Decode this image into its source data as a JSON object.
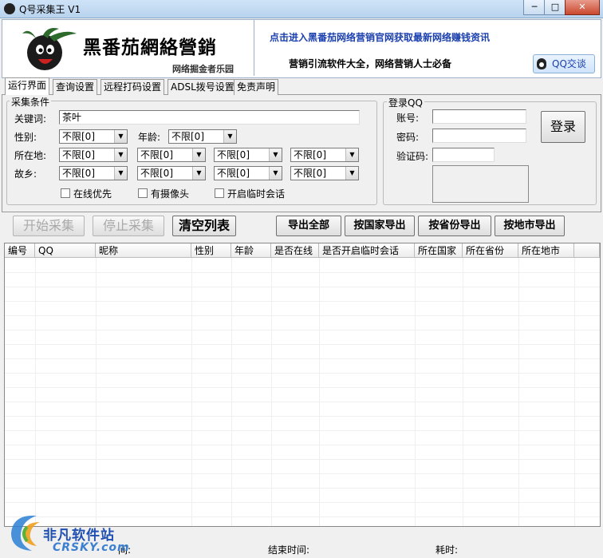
{
  "window": {
    "title": "Q号采集王 V1",
    "minimize": "─",
    "maximize": "□",
    "close": "✕"
  },
  "banner": {
    "logo_text": "黑番茄網絡營銷",
    "logo_sub": "网络掘金者乐园",
    "link": "点击进入黑番茄网络营销官网获取最新网络赚钱资讯",
    "slogan": "营销引流软件大全，网络营销人士必备",
    "qq_chat": "QQ交谈"
  },
  "tabs": [
    "运行界面",
    "查询设置",
    "远程打码设置",
    "ADSL拨号设置",
    "免责声明"
  ],
  "conditions": {
    "legend": "采集条件",
    "keyword_label": "关键词:",
    "keyword_value": "茶叶",
    "gender_label": "性别:",
    "gender_value": "不限[0]",
    "age_label": "年龄:",
    "age_value": "不限[0]",
    "location_label": "所在地:",
    "location_values": [
      "不限[0]",
      "不限[0]",
      "不限[0]",
      "不限[0]"
    ],
    "hometown_label": "故乡:",
    "hometown_values": [
      "不限[0]",
      "不限[0]",
      "不限[0]",
      "不限[0]"
    ],
    "online_first": "在线优先",
    "has_camera": "有摄像头",
    "temp_chat": "开启临时会话"
  },
  "login": {
    "legend": "登录QQ",
    "account_label": "账号:",
    "password_label": "密码:",
    "captcha_label": "验证码:",
    "login_button": "登录"
  },
  "actions": {
    "start": "开始采集",
    "stop": "停止采集",
    "clear": "清空列表",
    "export_all": "导出全部",
    "export_country": "按国家导出",
    "export_province": "按省份导出",
    "export_city": "按地市导出"
  },
  "table": {
    "columns": [
      "编号",
      "QQ",
      "昵称",
      "性别",
      "年龄",
      "是否在线",
      "是否开启临时会话",
      "所在国家",
      "所在省份",
      "所在地市"
    ]
  },
  "status": {
    "start_time": "间:",
    "end_time": "结束时间:",
    "elapsed": "耗时:"
  },
  "watermark": {
    "name": "非凡软件站",
    "domain": "CRSKY.com"
  }
}
